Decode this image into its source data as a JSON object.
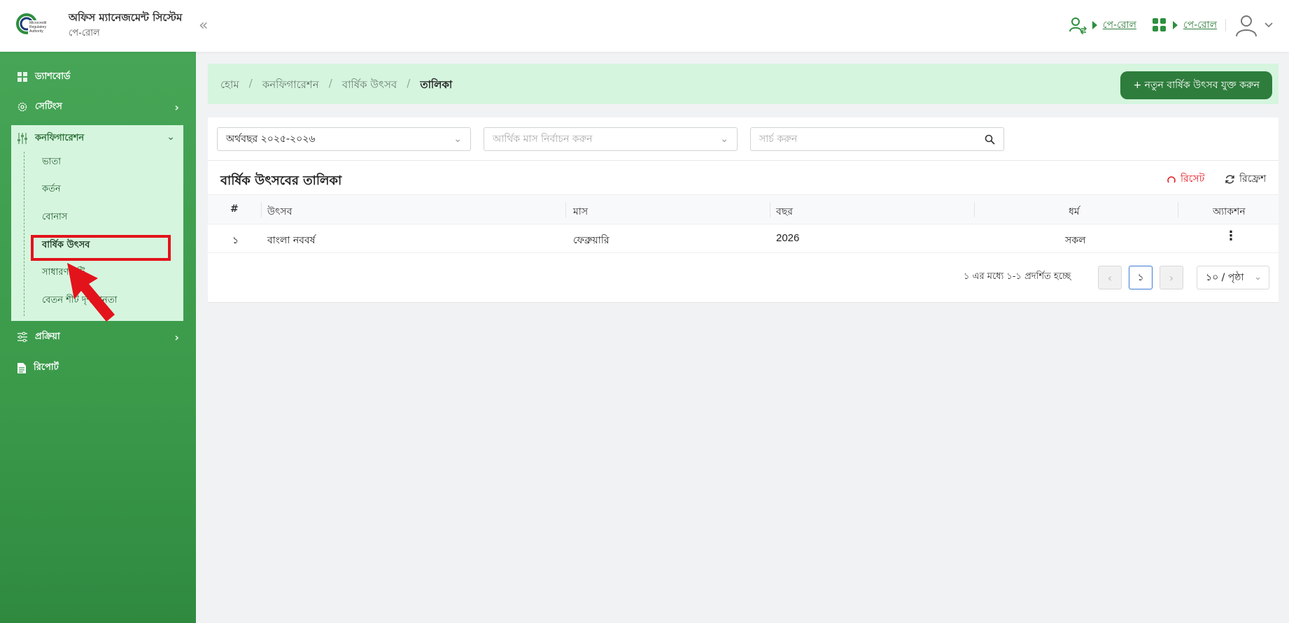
{
  "header": {
    "app_title": "অফিস ম্যানেজমেন্ট সিস্টেম",
    "app_subtitle": "পে-রোল",
    "collapse_icon": "«",
    "link1": "পে-রোল",
    "link2": "পে-রোল",
    "brand_color": "#2e7d3c"
  },
  "sidebar": {
    "dashboard": "ড্যাশবোর্ড",
    "settings": "সেটিংস",
    "configuration": "কনফিগারেশন",
    "sub_items": [
      "ভাতা",
      "কর্তন",
      "বোনাস",
      "বার্ষিক উৎসব",
      "সাধারণ ছুটি",
      "বেতন শীট দৃশ্যমানতা"
    ],
    "process": "প্রক্রিয়া",
    "report": "রিপোর্ট"
  },
  "breadcrumb": {
    "home": "হোম",
    "config": "কনফিগারেশন",
    "festival": "বার্ষিক উৎসব",
    "current": "তালিকা",
    "separator": "/"
  },
  "add_button": "+ নতুন বার্ষিক উৎসব যুক্ত করুন",
  "filters": {
    "fiscal_year": "অর্থবছর ২০২৫-২০২৬",
    "month_placeholder": "আর্থিক মাস নির্বাচন করুন",
    "search_placeholder": "সার্চ করুন"
  },
  "table": {
    "title": "বার্ষিক উৎসবের তালিকা",
    "reset": "রিসেট",
    "refresh": "রিফ্রেশ",
    "headers": [
      "#",
      "উৎসব",
      "মাস",
      "বছর",
      "ধর্ম",
      "অ্যাকশন"
    ],
    "rows": [
      {
        "no": "১",
        "festival": "বাংলা নববর্ষ",
        "month": "ফেব্রুয়ারি",
        "year": "2026",
        "religion": "সকল",
        "action": "⋮"
      }
    ]
  },
  "pagination": {
    "info": "১ এর মধ্যে ১-১ প্রদর্শিত হচ্ছে",
    "prev": "‹",
    "current": "১",
    "next": "›",
    "page_size": "১০ / পৃষ্ঠা"
  }
}
